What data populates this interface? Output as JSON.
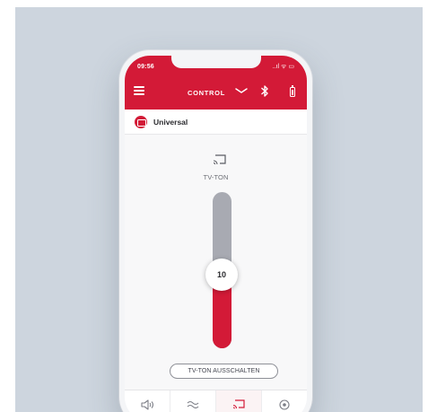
{
  "status_bar": {
    "time": "09:56",
    "icons": "..ıl ᯤ ▭"
  },
  "header": {
    "title": "CONTROL"
  },
  "device": {
    "name": "Universal"
  },
  "audio": {
    "mode_label": "TV-TON",
    "volume_display": "10",
    "volume_level_fraction": 0.47
  },
  "toggle_button": {
    "label": "TV-TON AUSSCHALTEN"
  },
  "tabs": [
    {
      "icon": "speaker-icon",
      "active": false
    },
    {
      "icon": "waves-icon",
      "active": false
    },
    {
      "icon": "cast-icon",
      "active": true
    },
    {
      "icon": "settings-icon",
      "active": false
    }
  ],
  "colors": {
    "accent": "#d31a37",
    "track": "#a8aab2",
    "background": "#cdd5de"
  }
}
